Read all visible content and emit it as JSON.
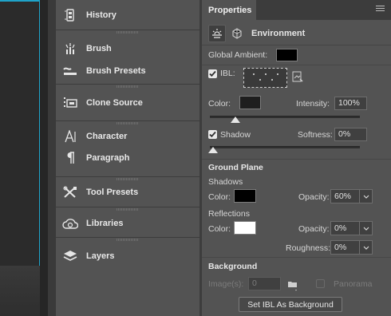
{
  "panels": [
    {
      "label": "History",
      "icon": "history-icon"
    },
    {
      "label": "Brush",
      "icon": "brush-icon"
    },
    {
      "label": "Brush Presets",
      "icon": "brush-presets-icon"
    },
    {
      "label": "Clone Source",
      "icon": "clone-source-icon"
    },
    {
      "label": "Character",
      "icon": "character-icon"
    },
    {
      "label": "Paragraph",
      "icon": "paragraph-icon"
    },
    {
      "label": "Tool Presets",
      "icon": "tool-presets-icon"
    },
    {
      "label": "Libraries",
      "icon": "libraries-icon"
    },
    {
      "label": "Layers",
      "icon": "layers-icon"
    }
  ],
  "properties": {
    "tab_title": "Properties",
    "section_title": "Environment",
    "global_ambient_label": "Global Ambient:",
    "ibl_label": "IBL:",
    "color_label": "Color:",
    "intensity_label": "Intensity:",
    "intensity_value": "100%",
    "shadow_label": "Shadow",
    "softness_label": "Softness:",
    "softness_value": "0%",
    "ground_plane_title": "Ground Plane",
    "shadows_label": "Shadows",
    "shadows_color_label": "Color:",
    "shadows_opacity_label": "Opacity:",
    "shadows_opacity_value": "60%",
    "reflections_label": "Reflections",
    "reflections_color_label": "Color:",
    "reflections_opacity_label": "Opacity:",
    "reflections_opacity_value": "0%",
    "roughness_label": "Roughness:",
    "roughness_value": "0%",
    "background_title": "Background",
    "images_label": "Image(s):",
    "images_value": "0",
    "panorama_label": "Panorama",
    "set_ibl_button": "Set IBL As Background",
    "colors": {
      "global_ambient": "#000000",
      "ibl_color": "#1e1e1e",
      "shadows_color": "#000000",
      "reflections_color": "#ffffff"
    },
    "ibl_checked": true,
    "shadow_checked": true,
    "panorama_checked": false
  }
}
